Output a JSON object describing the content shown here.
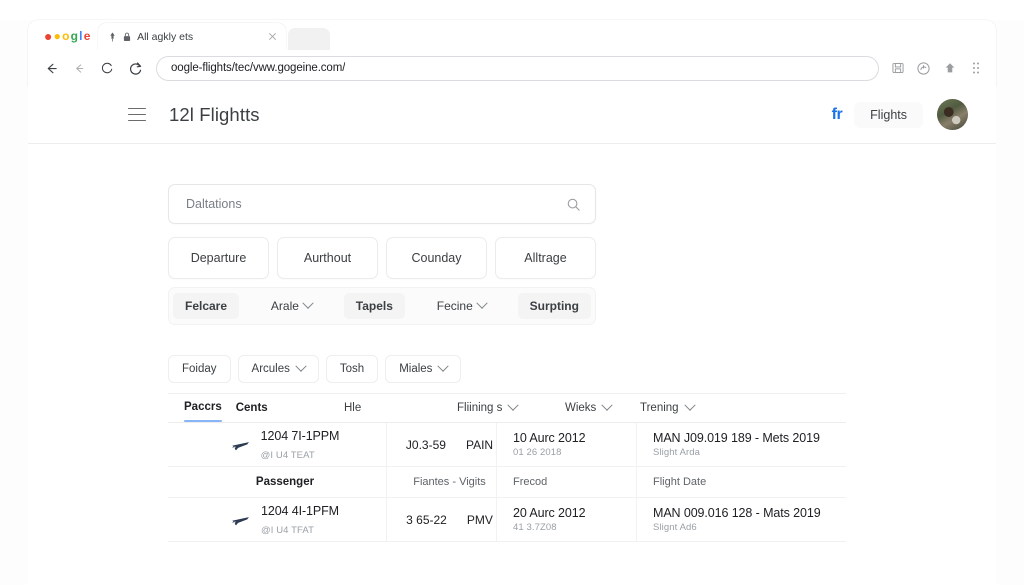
{
  "browser": {
    "tab": {
      "title": "All agkly ets",
      "pin_icon": "pin-icon",
      "lock_icon": "lock-icon",
      "close_icon": "close-icon"
    },
    "toolbar": {
      "back_icon": "back-arrow-icon",
      "forward_icon": "forward-arrow-icon",
      "reload_icon": "reload-icon",
      "reload_alt_icon": "reload-alt-icon",
      "url": "oogle-flights/tec/vww.gogeine.com/",
      "icons": [
        "save-page-icon",
        "extensions-icon",
        "home-icon",
        "menu-grid-icon"
      ]
    }
  },
  "app": {
    "menu_icon": "hamburger-menu-icon",
    "title": "12l Flightts",
    "brand_icon": "fr-icon",
    "account_pill": "Flights",
    "avatar": "user-avatar"
  },
  "search": {
    "placeholder": "Daltations",
    "value": "",
    "icon": "search-icon"
  },
  "filters": {
    "buttons": [
      {
        "label": "Departure"
      },
      {
        "label": "Aurthout"
      },
      {
        "label": "Counday"
      },
      {
        "label": "Alltrage"
      }
    ]
  },
  "actions": {
    "items": [
      {
        "label": "Felcare",
        "strong": true,
        "caret": false
      },
      {
        "label": "Arale",
        "strong": false,
        "caret": true
      },
      {
        "label": "Tapels",
        "strong": true,
        "caret": false
      },
      {
        "label": "Fecine",
        "strong": false,
        "caret": true
      },
      {
        "label": "Surpting",
        "strong": true,
        "caret": false
      }
    ]
  },
  "chips": [
    {
      "label": "Foiday",
      "caret": false
    },
    {
      "label": "Arcules",
      "caret": true
    },
    {
      "label": "Tosh",
      "caret": false
    },
    {
      "label": "Miales",
      "caret": true
    }
  ],
  "table": {
    "columns": [
      {
        "label": "Paccrs",
        "active": true,
        "strong": true,
        "caret": false
      },
      {
        "label": "Cents",
        "active": false,
        "strong": true,
        "caret": false
      },
      {
        "label": "Hle",
        "active": false,
        "strong": false,
        "caret": false
      },
      {
        "label": "Fliining s",
        "active": false,
        "strong": false,
        "caret": true
      },
      {
        "label": "Wieks",
        "active": false,
        "strong": false,
        "caret": true
      },
      {
        "label": "Trening",
        "active": false,
        "strong": false,
        "caret": true
      }
    ],
    "rows": [
      {
        "type": "flight",
        "icon": "airplane-icon",
        "name": "1204 7I-1PPM",
        "name_sub": "@I U4 TEAT",
        "code": "J0.3-59",
        "code2": "PAIN",
        "date": "10 Aurc 2012",
        "date_sub": "01 26 2018",
        "detail": "MAN J09.019 189  -  Mets 2019",
        "detail_sub": "Slight Arda"
      },
      {
        "type": "labels",
        "label_0": "Passenger",
        "label_1": "Fiantes - Vigits",
        "label_2": "Frecod",
        "label_3": "Flight Date"
      },
      {
        "type": "flight",
        "icon": "airplane-icon",
        "name": "1204 4I-1PFM",
        "name_sub": "@I U4 TFAT",
        "code": "3 65-22",
        "code2": "PMV",
        "date": "20 Aurc 2012",
        "date_sub": "41 3.7Z08",
        "detail": "MAN 009.016 128  -  Mats 2019",
        "detail_sub": "Slignt Ad6"
      }
    ]
  },
  "colors": {
    "accent": "#1a73e8",
    "tab_underline": "#8ab4f8",
    "text_primary": "#202124",
    "text_secondary": "#5f6368",
    "text_muted": "#9aa0a6",
    "border": "#ededed"
  }
}
